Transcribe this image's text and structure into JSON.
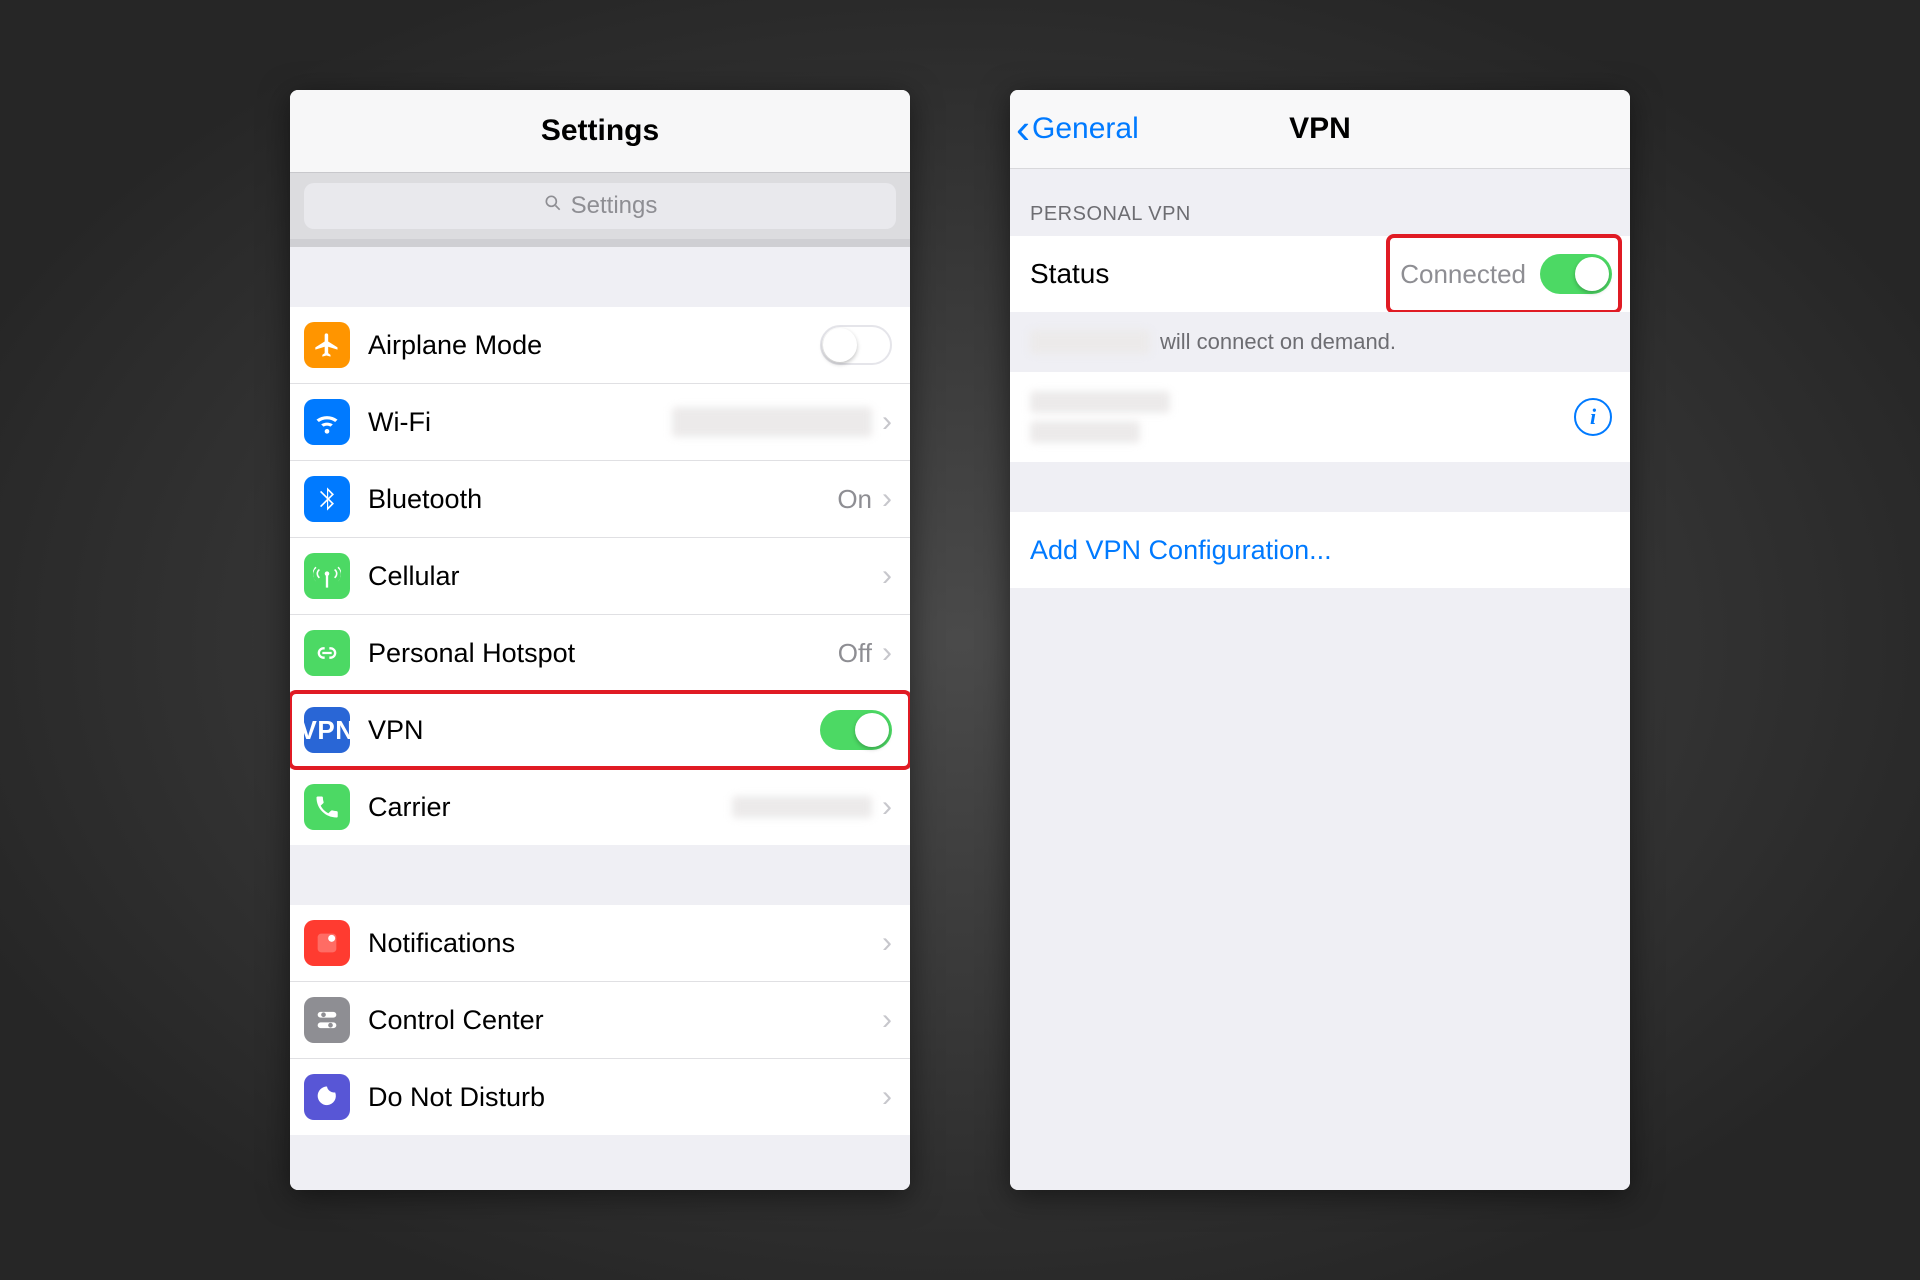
{
  "left": {
    "title": "Settings",
    "searchPlaceholder": "Settings",
    "rows": [
      {
        "label": "Airplane Mode"
      },
      {
        "label": "Wi-Fi"
      },
      {
        "label": "Bluetooth",
        "value": "On"
      },
      {
        "label": "Cellular"
      },
      {
        "label": "Personal Hotspot",
        "value": "Off"
      },
      {
        "label": "VPN"
      },
      {
        "label": "Carrier"
      }
    ],
    "rows2": [
      {
        "label": "Notifications"
      },
      {
        "label": "Control Center"
      },
      {
        "label": "Do Not Disturb"
      }
    ],
    "vpnBadge": "VPN"
  },
  "right": {
    "back": "General",
    "title": "VPN",
    "groupHeader": "PERSONAL VPN",
    "statusLabel": "Status",
    "statusValue": "Connected",
    "footerText": "will connect on demand.",
    "addLink": "Add VPN Configuration...",
    "infoGlyph": "i"
  }
}
